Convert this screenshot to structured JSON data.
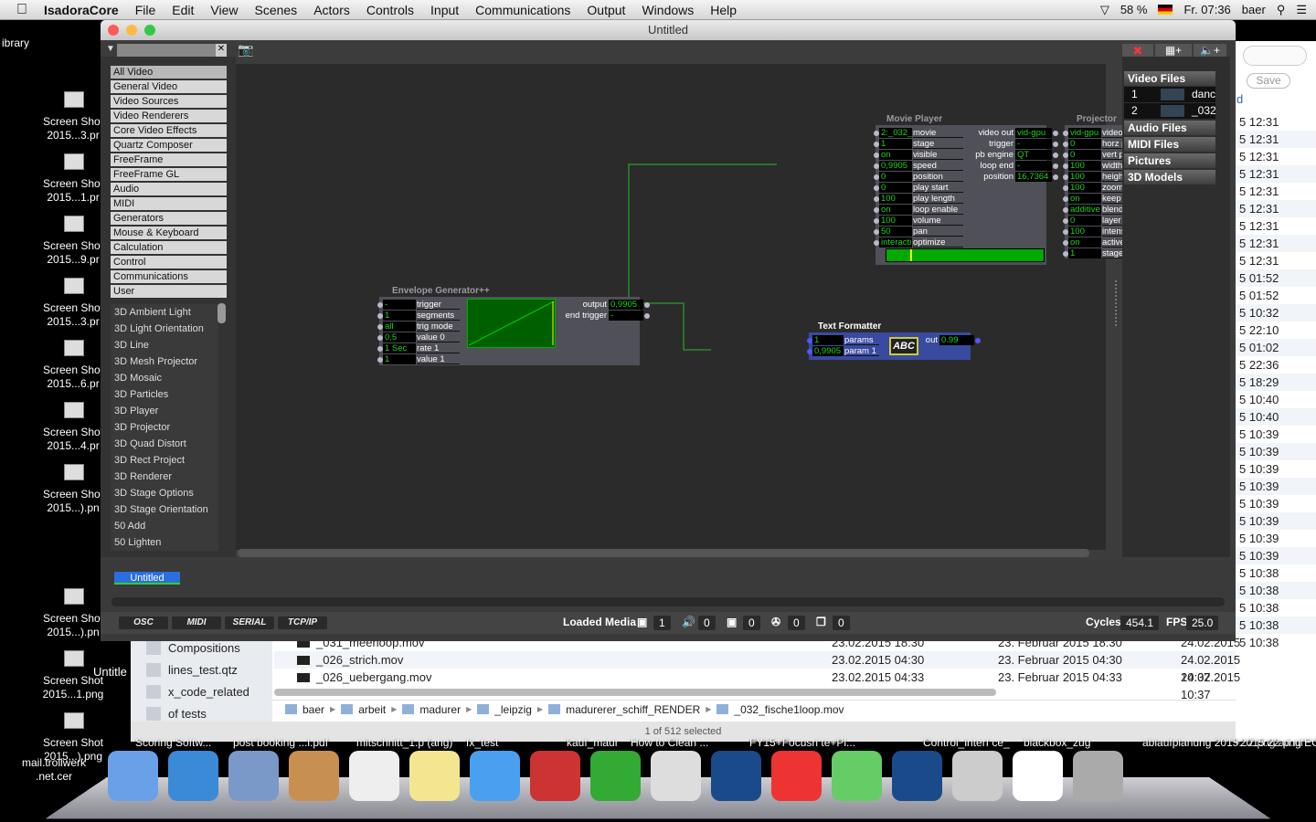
{
  "menubar": {
    "app": "IsadoraCore",
    "items": [
      "File",
      "Edit",
      "View",
      "Scenes",
      "Actors",
      "Controls",
      "Input",
      "Communications",
      "Output",
      "Windows",
      "Help"
    ],
    "battery": "58 %",
    "clock": "Fr. 07:36",
    "user": "baer"
  },
  "desktop": {
    "top_label": "ibrary",
    "icons": [
      {
        "l1": "Screen Shot",
        "l2": "2015...3.pr"
      },
      {
        "l1": "Screen Shot",
        "l2": "2015...1.pr"
      },
      {
        "l1": "Screen Shot",
        "l2": "2015...9.pr"
      },
      {
        "l1": "Screen Shot",
        "l2": "2015...3.pr"
      },
      {
        "l1": "Screen Shot",
        "l2": "2015...6.pr"
      },
      {
        "l1": "Screen Shot",
        "l2": "2015...4.pr"
      },
      {
        "l1": "Screen Shot",
        "l2": "2015...).pn"
      },
      {
        "l1": "Screen Shot",
        "l2": "2015...).pn"
      },
      {
        "l1": "Screen Shot",
        "l2": "2015...1.png"
      },
      {
        "l1": "Screen Shot",
        "l2": "2015...).png"
      }
    ],
    "mail": "mail.trollwerk .net.cer"
  },
  "isadora": {
    "title": "Untitled",
    "categories": [
      "All Video",
      "General Video",
      "Video Sources",
      "Video Renderers",
      "Core Video Effects",
      "Quartz Composer",
      "FreeFrame",
      "FreeFrame GL",
      "Audio",
      "MIDI",
      "Generators",
      "Mouse & Keyboard",
      "Calculation",
      "Control",
      "Communications",
      "User"
    ],
    "actors": [
      "3D Ambient Light",
      "3D Light Orientation",
      "3D Line",
      "3D Mesh Projector",
      "3D Mosaic",
      "3D Particles",
      "3D Player",
      "3D Projector",
      "3D Quad Distort",
      "3D Rect Project",
      "3D Renderer",
      "3D Stage Options",
      "3D Stage Orientation",
      "50 Add",
      "50 Lighten"
    ],
    "nodes": {
      "movie": {
        "title": "Movie Player",
        "inputs": [
          [
            "2:_032_",
            "movie"
          ],
          [
            "1",
            "stage"
          ],
          [
            "on",
            "visible"
          ],
          [
            "0,9905",
            "speed"
          ],
          [
            "0",
            "position"
          ],
          [
            "0",
            "play start"
          ],
          [
            "100",
            "play length"
          ],
          [
            "on",
            "loop enable"
          ],
          [
            "100",
            "volume"
          ],
          [
            "50",
            "pan"
          ],
          [
            "interacti",
            "optimize"
          ]
        ],
        "outputs": [
          [
            "video out",
            "vid-gpu"
          ],
          [
            "trigger",
            "-"
          ],
          [
            "pb engine",
            "QT"
          ],
          [
            "loop end",
            "-"
          ],
          [
            "position",
            "16,7364"
          ]
        ],
        "progress": 0.15
      },
      "projector": {
        "title": "Projector",
        "inputs": [
          [
            "vid-gpu",
            "video"
          ],
          [
            "0",
            "horz pos"
          ],
          [
            "0",
            "vert pos"
          ],
          [
            "100",
            "width"
          ],
          [
            "100",
            "height"
          ],
          [
            "100",
            "zoom"
          ],
          [
            "on",
            "keep aspect"
          ],
          [
            "additive",
            "blend"
          ],
          [
            "0",
            "layer"
          ],
          [
            "100",
            "intensity"
          ],
          [
            "on",
            "active"
          ],
          [
            "1",
            "stage"
          ]
        ]
      },
      "envelope": {
        "title": "Envelope Generator++",
        "inputs": [
          [
            "-",
            "trigger"
          ],
          [
            "1",
            "segments"
          ],
          [
            "all",
            "trig mode"
          ],
          [
            "0,5",
            "value 0"
          ],
          [
            "1 Sec",
            "rate 1"
          ],
          [
            "1",
            "value 1"
          ]
        ],
        "outputs": [
          [
            "output",
            "0,9905"
          ],
          [
            "end trigger",
            "-"
          ]
        ]
      },
      "text": {
        "title": "Text Formatter",
        "inputs": [
          [
            "1",
            "params"
          ],
          [
            "0,9905",
            "param 1"
          ]
        ],
        "outputs": [
          [
            "out",
            "0.99"
          ]
        ],
        "icon_label": "ABC"
      }
    },
    "media": {
      "sections": [
        "Video Files",
        "Audio Files",
        "MIDI Files",
        "Pictures",
        "3D Models"
      ],
      "video_files": [
        {
          "n": "1",
          "name": "danc"
        },
        {
          "n": "2",
          "name": "_032"
        }
      ]
    },
    "scene_tab": "Untitled",
    "status": {
      "buttons": [
        "OSC",
        "MIDI",
        "SERIAL",
        "TCP/IP"
      ],
      "loaded_media": "Loaded Media",
      "counts": [
        "1",
        "0",
        "0",
        "0",
        "0"
      ],
      "cycles_label": "Cycles",
      "cycles": "454.1",
      "fps_label": "FPS",
      "fps": "25.0"
    },
    "colors": {
      "wire": "#2a8a2a",
      "value_text": "#1ed41e",
      "scene_tab": "#2a6ee0"
    }
  },
  "finder": {
    "save": "Save",
    "col_head": "d",
    "times": [
      "5 12:31",
      "5 12:31",
      "5 12:31",
      "5 12:31",
      "5 12:31",
      "5 12:31",
      "5 12:31",
      "5 12:31",
      "5 12:31",
      "5 01:52",
      "5 01:52",
      "5 10:32",
      "5 22:10",
      "5 01:02",
      "5 22:36",
      "5 18:29",
      "5 10:40",
      "5 10:40",
      "5 10:39",
      "5 10:39",
      "5 10:39",
      "5 10:39",
      "5 10:39",
      "5 10:39",
      "5 10:39",
      "5 10:39",
      "5 10:38",
      "5 10:38",
      "5 10:38",
      "5 10:38",
      "5 10:38"
    ],
    "sidebar": [
      "Compositions",
      "lines_test.qtz",
      "x_code_related",
      "of tests"
    ],
    "sidebar_extra": "Untitle",
    "rows": [
      {
        "name": "_031_meerloop.mov",
        "d1": "23.02.2015 18:30",
        "d2": "23. Februar 2015 18:30",
        "d3": "24.02.2015 10:38"
      },
      {
        "name": "_026_strich.mov",
        "d1": "23.02.2015 04:30",
        "d2": "23. Februar 2015 04:30",
        "d3": "24.02.2015 10:37"
      },
      {
        "name": "_026_uebergang.mov",
        "d1": "23.02.2015 04:33",
        "d2": "23. Februar 2015 04:33",
        "d3": "24.02.2015 10:37"
      }
    ],
    "path": [
      "baer",
      "arbeit",
      "madurer",
      "_leipzig",
      "madurerer_schiff_RENDER",
      "_032_fische1loop.mov"
    ],
    "status": "1 of 512 selected"
  },
  "dock": {
    "labels": [
      "Scoring Softw...",
      "post booking ...l.pdf",
      "mitschnitt_1.p (ang)",
      "fx_test",
      "kauf_maur",
      "How to Clean ...",
      "FY15+Focusri te+Pl...",
      "Control_interf ce_",
      "blackbox_zug",
      "ablaufplanung 2015...2.png ad.rtf",
      "+2015.22.png ECSH...5.pdf"
    ]
  }
}
